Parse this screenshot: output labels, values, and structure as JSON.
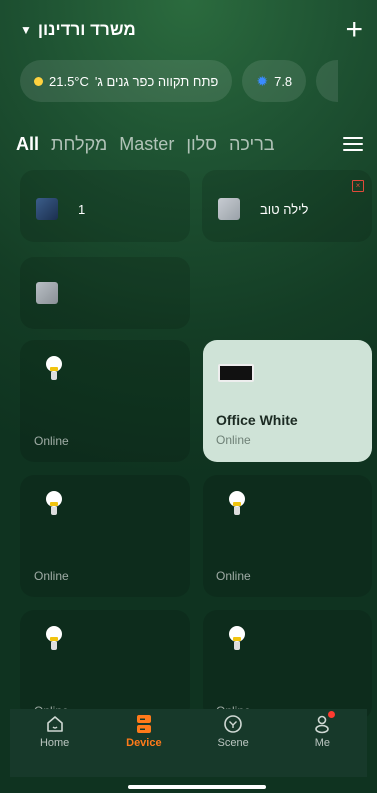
{
  "header": {
    "home_name": "משרד ורדינון",
    "caret": "▼",
    "add": "+"
  },
  "weather": {
    "temp_text": "21.5°C",
    "location_text": "פתח תקווה כפר גנים ג'",
    "uv_value": "7.8"
  },
  "tabs": [
    "All",
    "מקלחת",
    "Master",
    "סלון",
    "בריכה"
  ],
  "devices": {
    "row1_left_name": "1",
    "row1_right_name": "לילה טוב",
    "office_name": "Office White",
    "status_online": "Online"
  },
  "nav": {
    "home": "Home",
    "device": "Device",
    "scene": "Scene",
    "me": "Me"
  },
  "colors": {
    "accent": "#ff7a1a",
    "sun": "#ffd23f",
    "uv": "#3a8bff",
    "alert": "#e04a3a"
  }
}
